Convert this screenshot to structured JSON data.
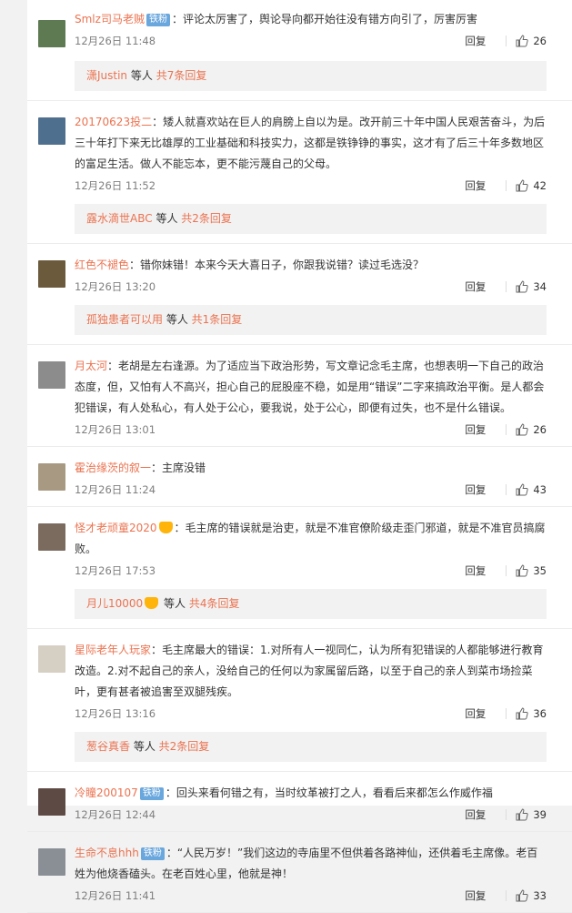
{
  "comments": [
    {
      "user": "Smlz司马老贼",
      "badge": "铁粉",
      "text": "：评论太厉害了，舆论导向都开始往没有错方向引了，厉害厉害",
      "time": "12月26日 11:48",
      "reply": "回复",
      "likes": "26",
      "avatar_color": "#5d7a52",
      "sub": {
        "who": "潇Justin",
        "mid": " 等人 ",
        "count": "共7条回复"
      }
    },
    {
      "user": "20170623投二",
      "text": "：矮人就喜欢站在巨人的肩膀上自以为是。改开前三十年中国人民艰苦奋斗，为后三十年打下来无比雄厚的工业基础和科技实力，这都是铁铮铮的事实，这才有了后三十年多数地区的富足生活。做人不能忘本，更不能污蔑自己的父母。",
      "time": "12月26日 11:52",
      "reply": "回复",
      "likes": "42",
      "avatar_color": "#4f6f8e",
      "sub": {
        "who": "露水滴世ABC",
        "mid": " 等人 ",
        "count": "共2条回复"
      }
    },
    {
      "user": "红色不褪色",
      "text": "：错你妹错！本来今天大喜日子，你跟我说错？读过毛选没？",
      "time": "12月26日 13:20",
      "reply": "回复",
      "likes": "34",
      "avatar_color": "#6b5a3c",
      "sub": {
        "who": "孤独患者可以用",
        "mid": " 等人 ",
        "count": "共1条回复"
      }
    },
    {
      "user": "月太河",
      "text": "：老胡是左右逢源。为了适应当下政治形势，写文章记念毛主席，也想表明一下自己的政治态度，但，又怕有人不高兴，担心自己的屁股座不稳，如是用“错误”二字来搞政治平衡。是人都会犯错误，有人处私心，有人处于公心，要我说，处于公心，即便有过失，也不是什么错误。",
      "time": "12月26日 13:01",
      "reply": "回复",
      "likes": "26",
      "avatar_color": "#8c8c8c"
    },
    {
      "user": "霍治缘茨的叙一",
      "text": "：主席没错",
      "time": "12月26日 11:24",
      "reply": "回复",
      "likes": "43",
      "avatar_color": "#a89a82"
    },
    {
      "user": "怪才老顽童2020",
      "vip": true,
      "text": "：毛主席的错误就是治吏，就是不准官僚阶级走歪门邪道，就是不准官员搞腐败。",
      "time": "12月26日 17:53",
      "reply": "回复",
      "likes": "35",
      "avatar_color": "#7b6a5e",
      "sub": {
        "who": "月儿10000",
        "vip": true,
        "mid": " 等人 ",
        "count": "共4条回复"
      }
    },
    {
      "user": "星际老年人玩家",
      "text": "：毛主席最大的错误：1.对所有人一视同仁，认为所有犯错误的人都能够进行教育改造。2.对不起自己的亲人，没给自己的任何以为家属留后路，以至于自己的亲人到菜市场捡菜叶，更有甚者被追害至双腿残疾。",
      "time": "12月26日 13:16",
      "reply": "回复",
      "likes": "36",
      "avatar_color": "#d6d0c4",
      "sub": {
        "who": "葱谷真香",
        "mid": " 等人 ",
        "count": "共2条回复"
      }
    },
    {
      "user": "冷瞳200107",
      "badge": "铁粉",
      "text": "：回头来看何错之有，当时纹革被打之人，看看后来都怎么作威作福",
      "time": "12月26日 12:44",
      "reply": "回复",
      "likes": "39",
      "avatar_color": "#5e4a44"
    },
    {
      "user": "生命不息hhh",
      "badge": "铁粉",
      "text": "：“人民万岁！”我们这边的寺庙里不但供着各路神仙，还供着毛主席像。老百姓为他烧香磕头。在老百姓心里，他就是神！",
      "time": "12月26日 11:41",
      "reply": "回复",
      "likes": "33",
      "avatar_color": "#8a8f96"
    }
  ]
}
